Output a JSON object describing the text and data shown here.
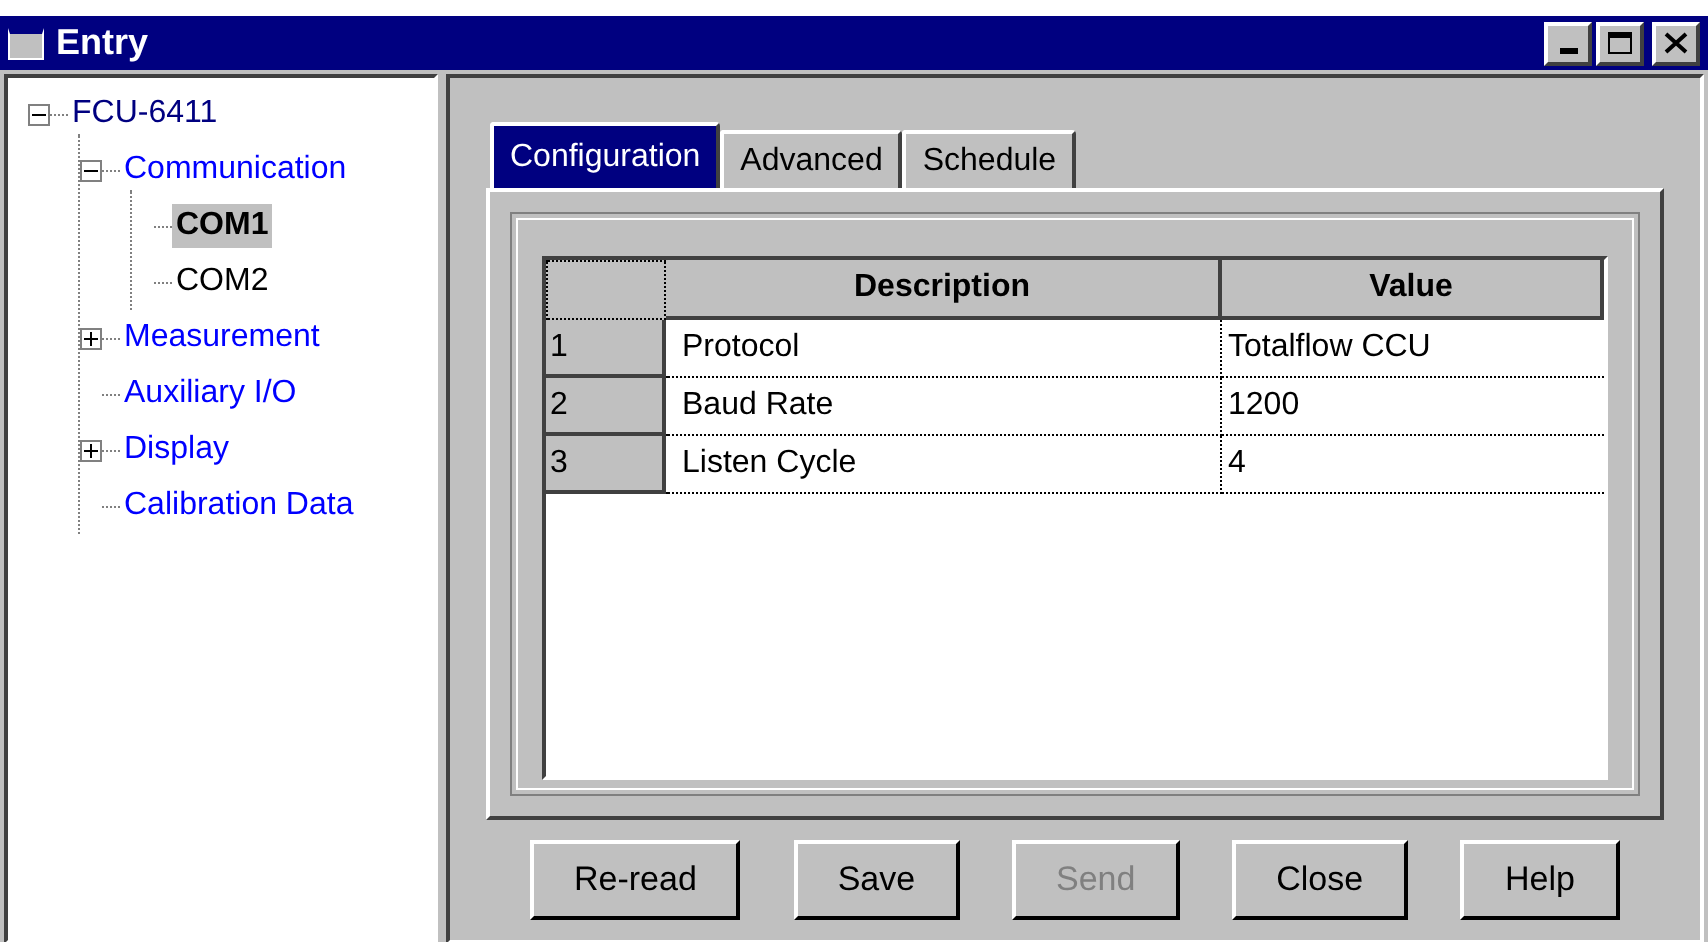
{
  "window": {
    "title": "Entry"
  },
  "tree": [
    {
      "label": "FCU-6411",
      "color": "#000080",
      "selected": false,
      "expanded": true,
      "children": [
        {
          "label": "Communication",
          "color": "#0000ff",
          "selected": false,
          "expanded": true,
          "children": [
            {
              "label": "COM1",
              "color": "#000000",
              "selected": true
            },
            {
              "label": "COM2",
              "color": "#000000",
              "selected": false
            }
          ]
        },
        {
          "label": "Measurement",
          "color": "#0000ff",
          "selected": false,
          "expanded": false
        },
        {
          "label": "Auxiliary I/O",
          "color": "#0000ff",
          "selected": false
        },
        {
          "label": "Display",
          "color": "#0000ff",
          "selected": false,
          "expanded": false
        },
        {
          "label": "Calibration Data",
          "color": "#0000ff",
          "selected": false
        }
      ]
    }
  ],
  "tabs": [
    {
      "label": "Configuration",
      "selected": true
    },
    {
      "label": "Advanced",
      "selected": false
    },
    {
      "label": "Schedule",
      "selected": false
    }
  ],
  "table": {
    "columns": [
      "Description",
      "Value"
    ],
    "rows": [
      {
        "number": "1",
        "description": "Protocol",
        "value": "Totalflow CCU"
      },
      {
        "number": "2",
        "description": "Baud Rate",
        "value": "1200"
      },
      {
        "number": "3",
        "description": "Listen Cycle",
        "value": "4"
      }
    ]
  },
  "buttons": [
    {
      "label": "Re-read",
      "disabled": false
    },
    {
      "label": "Save",
      "disabled": false
    },
    {
      "label": "Send",
      "disabled": true
    },
    {
      "label": "Close",
      "disabled": false
    },
    {
      "label": "Help",
      "disabled": false
    }
  ]
}
